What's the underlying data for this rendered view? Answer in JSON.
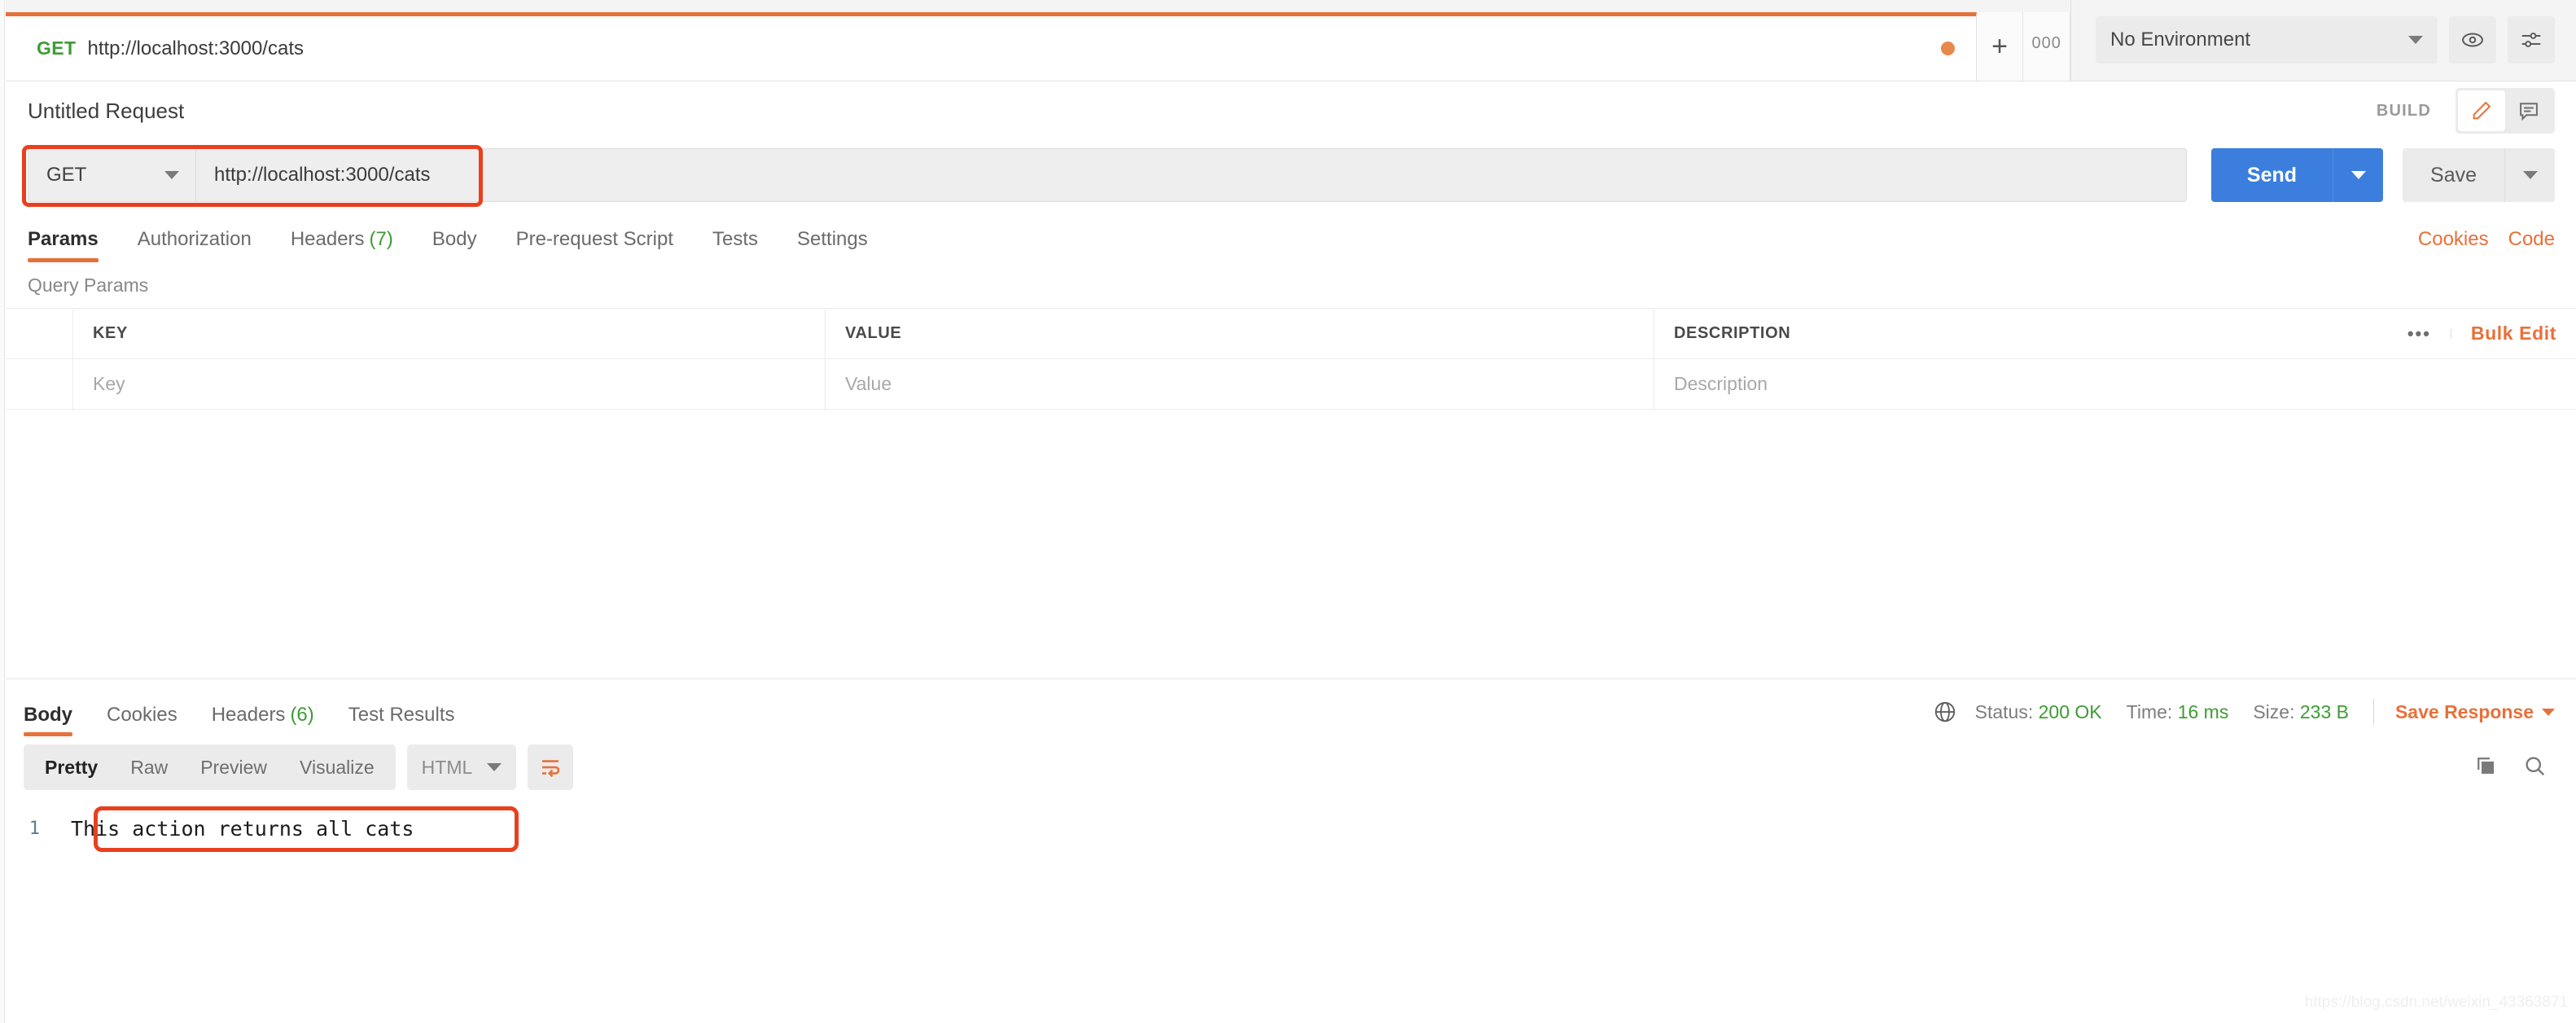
{
  "tabbar": {
    "request_tab": {
      "method": "GET",
      "url": "http://localhost:3000/cats",
      "unsaved": true
    },
    "new_tab_label": "+",
    "more_tabs_label": "000",
    "environment": {
      "selected": "No Environment"
    },
    "eye_icon": "eye-icon",
    "settings_icon": "sliders-icon"
  },
  "title_row": {
    "title": "Untitled Request",
    "build_label": "BUILD",
    "edit_icon": "pencil-icon",
    "comment_icon": "comment-icon"
  },
  "url_row": {
    "method": "GET",
    "url": "http://localhost:3000/cats",
    "send_label": "Send",
    "save_label": "Save",
    "highlight_color": "#e8401f",
    "send_color": "#3b7edd"
  },
  "request_tabs": {
    "items": [
      {
        "label": "Params",
        "count": "",
        "active": true
      },
      {
        "label": "Authorization",
        "count": "",
        "active": false
      },
      {
        "label": "Headers",
        "count": "(7)",
        "active": false
      },
      {
        "label": "Body",
        "count": "",
        "active": false
      },
      {
        "label": "Pre-request Script",
        "count": "",
        "active": false
      },
      {
        "label": "Tests",
        "count": "",
        "active": false
      },
      {
        "label": "Settings",
        "count": "",
        "active": false
      }
    ],
    "cookies_link": "Cookies",
    "code_link": "Code"
  },
  "query_params": {
    "section_label": "Query Params",
    "columns": [
      "KEY",
      "VALUE",
      "DESCRIPTION"
    ],
    "rows": [
      {
        "key": "Key",
        "value": "Value",
        "description": "Description"
      }
    ],
    "more_label": "•••",
    "bulk_edit_label": "Bulk Edit"
  },
  "response": {
    "tabs": [
      {
        "label": "Body",
        "count": "",
        "active": true
      },
      {
        "label": "Cookies",
        "count": "",
        "active": false
      },
      {
        "label": "Headers",
        "count": "(6)",
        "active": false
      },
      {
        "label": "Test Results",
        "count": "",
        "active": false
      }
    ],
    "status_label": "Status:",
    "status_value": "200 OK",
    "time_label": "Time:",
    "time_value": "16 ms",
    "size_label": "Size:",
    "size_value": "233 B",
    "save_response_label": "Save Response",
    "globe_icon": "globe-icon",
    "view_modes": [
      {
        "label": "Pretty",
        "active": true
      },
      {
        "label": "Raw",
        "active": false
      },
      {
        "label": "Preview",
        "active": false
      },
      {
        "label": "Visualize",
        "active": false
      }
    ],
    "format": "HTML",
    "wrap_icon": "word-wrap-icon",
    "copy_icon": "copy-icon",
    "search_icon": "search-icon",
    "body_lines": [
      {
        "number": "1",
        "text": "This action returns all cats"
      }
    ]
  },
  "watermark": "https://blog.csdn.net/weixin_43363871"
}
